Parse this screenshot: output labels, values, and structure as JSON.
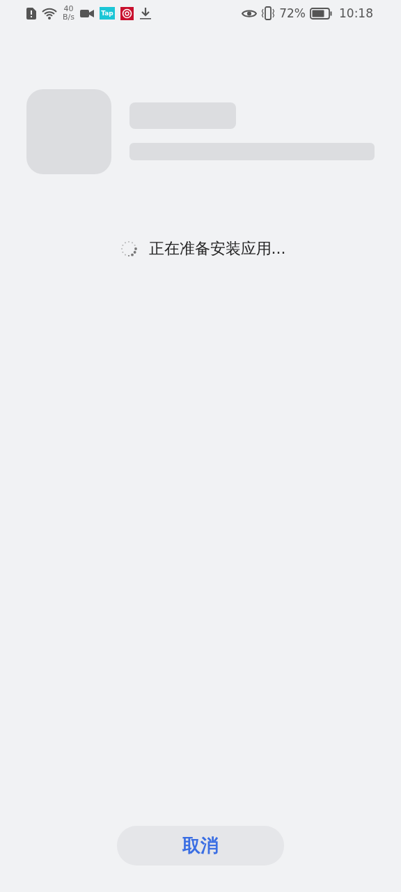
{
  "status_bar": {
    "net_speed_value": "40",
    "net_speed_unit": "B/s",
    "app_badge": "Tap",
    "battery_percent": "72%",
    "time": "10:18"
  },
  "loading": {
    "message": "正在准备安装应用..."
  },
  "buttons": [
    {
      "kind": "cancel",
      "label": "取消"
    }
  ]
}
